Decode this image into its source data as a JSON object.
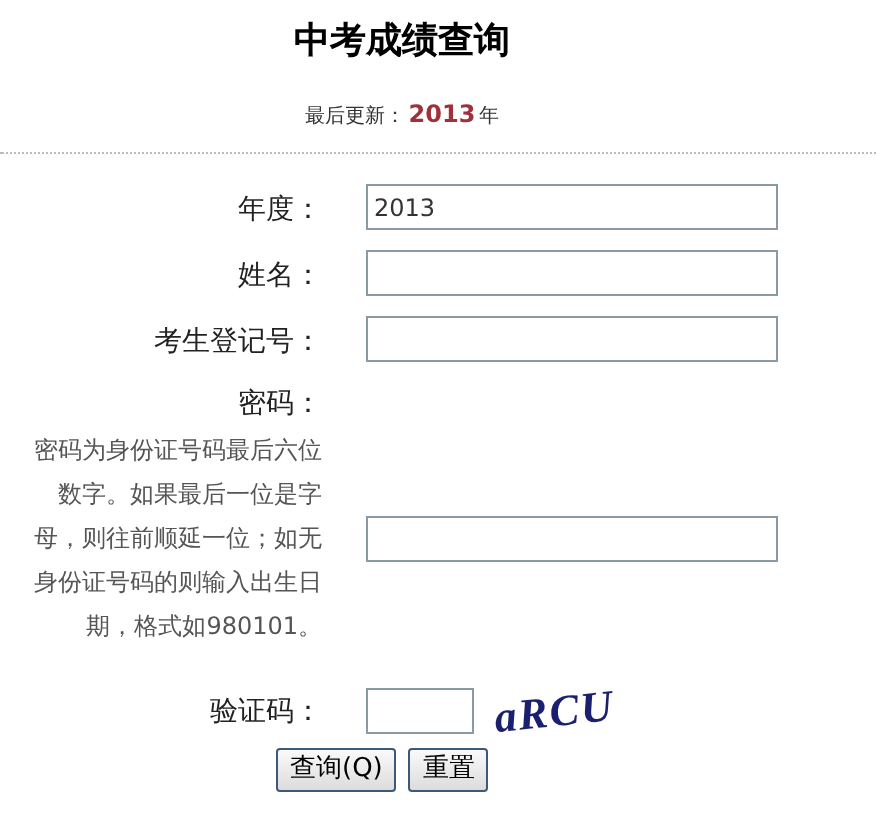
{
  "title": "中考成绩查询",
  "updated": {
    "label": "最后更新：",
    "year": "2013",
    "unit": "年"
  },
  "fields": [
    {
      "kind": "text",
      "label": "年度：",
      "value": "2013"
    },
    {
      "kind": "text",
      "label": "姓名："
    },
    {
      "kind": "text",
      "label": "考生登记号："
    },
    {
      "kind": "password",
      "label": "密码：",
      "hint": "密码为身份证号码最后六位数字。如果最后一位是字母，则往前顺延一位；如无身份证号码的则输入出生日期，格式如980101。"
    },
    {
      "kind": "captcha",
      "label": "验证码：",
      "captcha": "aRCU"
    }
  ],
  "buttons": [
    "查询(Q)",
    "重置"
  ]
}
